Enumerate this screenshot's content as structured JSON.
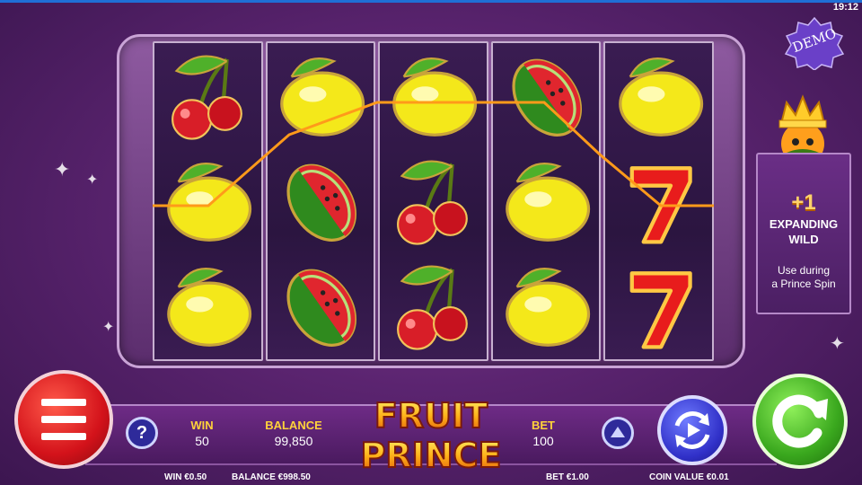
{
  "status_bar": {
    "time": "19:12"
  },
  "badge": {
    "demo": "DEMO"
  },
  "reels": [
    [
      "cherry",
      "lemon",
      "lemon"
    ],
    [
      "lemon",
      "watermelon",
      "watermelon"
    ],
    [
      "lemon",
      "cherry",
      "cherry"
    ],
    [
      "watermelon",
      "lemon",
      "lemon"
    ],
    [
      "lemon",
      "seven",
      "seven"
    ]
  ],
  "side_panel": {
    "bonus": "+1",
    "title_line1": "EXPANDING",
    "title_line2": "WILD",
    "desc_line1": "Use during",
    "desc_line2": "a Prince Spin"
  },
  "controls": {
    "win_label": "WIN",
    "win_value": "50",
    "balance_label": "BALANCE",
    "balance_value": "99,850",
    "bet_label": "BET",
    "bet_value": "100",
    "help_label": "?"
  },
  "logo": {
    "line1": "FRUIT",
    "line2": "PRINCE"
  },
  "footer": {
    "win": "WIN €0.50",
    "balance": "BALANCE €998.50",
    "bet": "BET €1.00",
    "coin_value": "COIN VALUE €0.01"
  },
  "colors": {
    "accent_yellow": "#ffd23a",
    "payline": "#ff9a1a",
    "spin_green": "#3aa81e",
    "menu_red": "#d3121a"
  }
}
